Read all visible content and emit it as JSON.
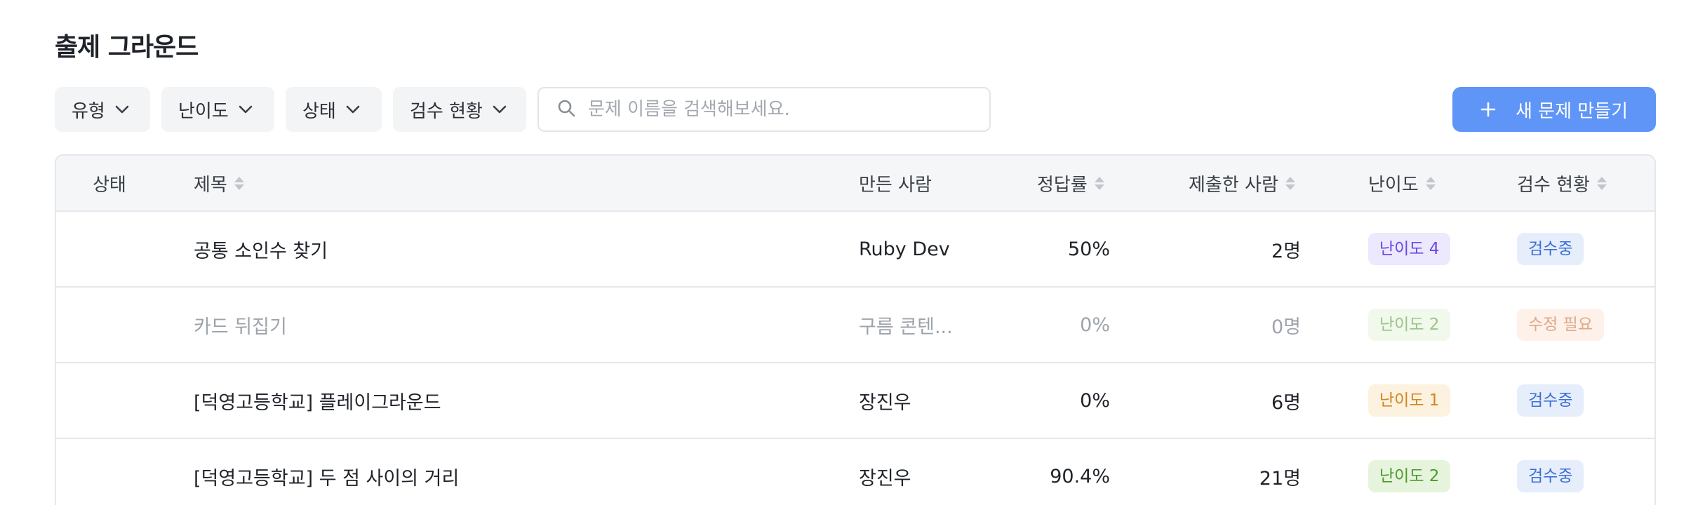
{
  "page": {
    "title": "출제 그라운드"
  },
  "filters": [
    {
      "label": "유형"
    },
    {
      "label": "난이도"
    },
    {
      "label": "상태"
    },
    {
      "label": "검수 현황"
    }
  ],
  "search": {
    "placeholder": "문제 이름을 검색해보세요.",
    "value": ""
  },
  "create_button": {
    "label": "새 문제 만들기"
  },
  "icons": {
    "filter_chevron": "chevron-down-icon",
    "search": "search-icon",
    "plus": "plus-icon",
    "sort": "sort-icon"
  },
  "colors": {
    "accent": "#5f95f6"
  },
  "table": {
    "columns": {
      "status": "상태",
      "title": "제목",
      "author": "만든 사람",
      "rate": "정답률",
      "submitters": "제출한 사람",
      "level": "난이도",
      "review": "검수 현황"
    },
    "rows": [
      {
        "title": "공통 소인수 찾기",
        "author": "Ruby Dev",
        "rate": "50%",
        "submitters": "2명",
        "level": "난이도 4",
        "level_bg": "#ece8fd",
        "level_fg": "#6b46e5",
        "review": "검수중",
        "review_bg": "#e6eefc",
        "review_fg": "#3c6fd6",
        "muted": false
      },
      {
        "title": "카드 뒤집기",
        "author": "구름 콘텐...",
        "rate": "0%",
        "submitters": "0명",
        "level": "난이도 2",
        "level_bg": "#f1f8ec",
        "level_fg": "#9bc486",
        "review": "수정 필요",
        "review_bg": "#fdf1ea",
        "review_fg": "#e0a886",
        "muted": true
      },
      {
        "title": "[덕영고등학교] 플레이그라운드",
        "author": "장진우",
        "rate": "0%",
        "submitters": "6명",
        "level": "난이도 1",
        "level_bg": "#fdf1e0",
        "level_fg": "#d1871f",
        "review": "검수중",
        "review_bg": "#e6eefc",
        "review_fg": "#3c6fd6",
        "muted": false
      },
      {
        "title": "[덕영고등학교] 두 점 사이의 거리",
        "author": "장진우",
        "rate": "90.4%",
        "submitters": "21명",
        "level": "난이도 2",
        "level_bg": "#e6f4dd",
        "level_fg": "#4c9a2a",
        "review": "검수중",
        "review_bg": "#e6eefc",
        "review_fg": "#3c6fd6",
        "muted": false
      }
    ]
  }
}
